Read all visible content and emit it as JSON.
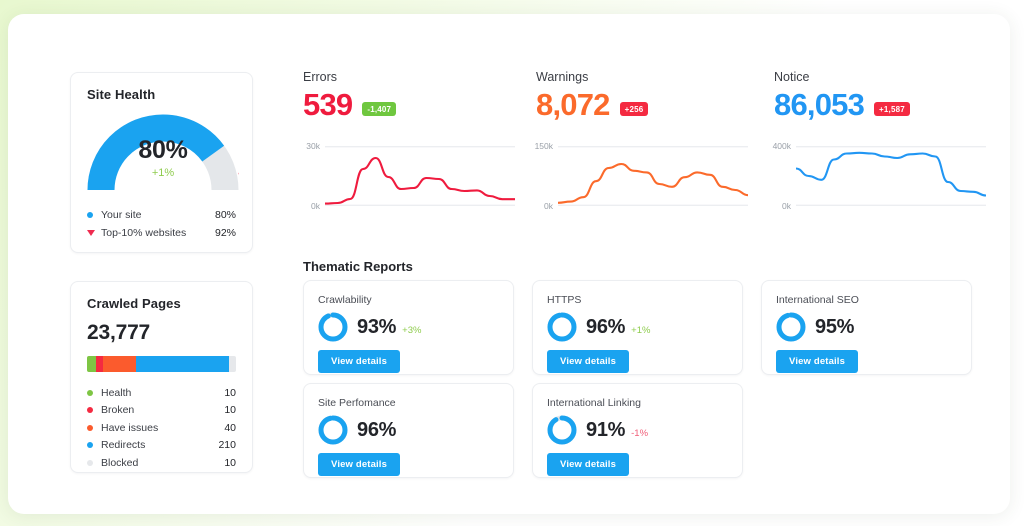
{
  "site_health": {
    "title": "Site Health",
    "gauge_value": "80%",
    "gauge_delta": "+1%",
    "gauge_percent": 80,
    "marker_percent": 92,
    "legend": [
      {
        "marker": "dot-blue-icon",
        "label": "Your site",
        "value": "80%"
      },
      {
        "marker": "triangle-red-icon",
        "label": "Top-10% websites",
        "value": "92%"
      }
    ]
  },
  "crawled_pages": {
    "title": "Crawled Pages",
    "total": "23,777",
    "segments": [
      {
        "label": "Health",
        "value": "10",
        "color": "#7ec544",
        "width": 6
      },
      {
        "label": "Broken",
        "value": "10",
        "color": "#f42a41",
        "width": 5
      },
      {
        "label": "Have issues",
        "value": "40",
        "color": "#fb5b2d",
        "width": 22
      },
      {
        "label": "Redirects",
        "value": "210",
        "color": "#1aa3f0",
        "width": 62
      },
      {
        "label": "Blocked",
        "value": "10",
        "color": "#e6e8eb",
        "width": 5
      }
    ]
  },
  "kpis": [
    {
      "title": "Errors",
      "value": "539",
      "color": "#ef1b3e",
      "badge": "-1,407",
      "badge_color": "#6fc73f",
      "axis_top": "30k",
      "axis_bottom": "0k"
    },
    {
      "title": "Warnings",
      "value": "8,072",
      "color": "#fb6a2b",
      "badge": "+256",
      "badge_color": "#f42a41",
      "axis_top": "150k",
      "axis_bottom": "0k"
    },
    {
      "title": "Notice",
      "value": "86,053",
      "color": "#2196f3",
      "badge": "+1,587",
      "badge_color": "#f42a41",
      "axis_top": "400k",
      "axis_bottom": "0k"
    }
  ],
  "thematic": {
    "title": "Thematic Reports",
    "cards": [
      {
        "title": "Crawlability",
        "value": "93%",
        "percent": 93,
        "delta": "+3%",
        "delta_dir": "up",
        "button": "View details"
      },
      {
        "title": "HTTPS",
        "value": "96%",
        "percent": 96,
        "delta": "+1%",
        "delta_dir": "up",
        "button": "View details"
      },
      {
        "title": "International SEO",
        "value": "95%",
        "percent": 95,
        "delta": "",
        "delta_dir": "none",
        "button": "View details"
      },
      {
        "title": "Site Perfomance",
        "value": "96%",
        "percent": 96,
        "delta": "",
        "delta_dir": "none",
        "button": "View details"
      },
      {
        "title": "International Linking",
        "value": "91%",
        "percent": 91,
        "delta": "-1%",
        "delta_dir": "down",
        "button": "View details"
      }
    ]
  },
  "chart_data": [
    {
      "type": "line",
      "title": "Errors",
      "ylabel": "",
      "xlabel": "",
      "ylim": [
        0,
        30000
      ],
      "tick_labels": [
        "0k",
        "30k"
      ],
      "grid": true,
      "legend": "none",
      "color": "#ef1b3e",
      "x": [
        0,
        1,
        2,
        3,
        4,
        5,
        6,
        7,
        8,
        9,
        10,
        11,
        12,
        13,
        14,
        15
      ],
      "values": [
        1200,
        1500,
        3500,
        18500,
        24000,
        14500,
        8500,
        9000,
        14000,
        13500,
        8500,
        7500,
        7800,
        5000,
        3400,
        3400
      ]
    },
    {
      "type": "line",
      "title": "Warnings",
      "ylabel": "",
      "xlabel": "",
      "ylim": [
        0,
        150000
      ],
      "tick_labels": [
        "0k",
        "150k"
      ],
      "grid": true,
      "legend": "none",
      "color": "#fb6a2b",
      "x": [
        0,
        1,
        2,
        3,
        4,
        5,
        6,
        7,
        8,
        9,
        10,
        11,
        12,
        13,
        14,
        15
      ],
      "values": [
        8000,
        11000,
        22000,
        62000,
        95000,
        105000,
        88000,
        84000,
        55000,
        48000,
        72000,
        84000,
        78000,
        48000,
        40000,
        27000
      ]
    },
    {
      "type": "line",
      "title": "Notice",
      "ylabel": "",
      "xlabel": "",
      "ylim": [
        0,
        400000
      ],
      "tick_labels": [
        "0k",
        "400k"
      ],
      "grid": true,
      "legend": "none",
      "color": "#2196f3",
      "x": [
        0,
        1,
        2,
        3,
        4,
        5,
        6,
        7,
        8,
        9,
        10,
        11,
        12,
        13,
        14,
        15
      ],
      "values": [
        250000,
        200000,
        175000,
        310000,
        350000,
        355000,
        350000,
        330000,
        320000,
        345000,
        350000,
        330000,
        160000,
        100000,
        95000,
        70000
      ]
    }
  ]
}
